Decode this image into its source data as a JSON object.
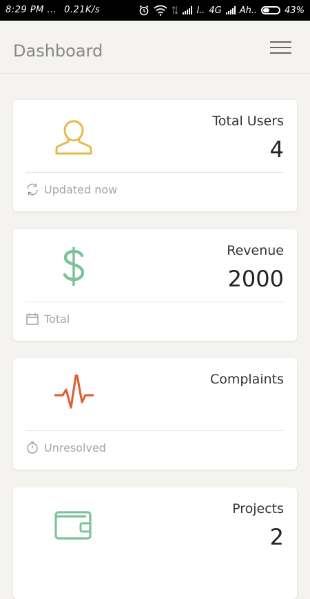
{
  "status_bar": {
    "time": "8:29 PM",
    "dots": "...",
    "speed": "0.21K/s",
    "network_a": "l..",
    "network_b": "4G",
    "carrier": "Ah..",
    "battery_percent": "43%",
    "battery_level": 0.43,
    "icons": [
      "alarm-icon",
      "wifi-icon",
      "data-arrows-icon",
      "signal-icon",
      "signal-icon",
      "battery-icon"
    ]
  },
  "header": {
    "title": "Dashboard",
    "menu_icon": "hamburger-menu-icon"
  },
  "cards": [
    {
      "label": "Total Users",
      "value": "4",
      "icon": "user-icon",
      "icon_color": "#e8b84a",
      "footer_icon": "refresh-icon",
      "footer_text": "Updated now"
    },
    {
      "label": "Revenue",
      "value": "2000",
      "icon": "dollar-icon",
      "icon_color": "#7cc39b",
      "footer_icon": "calendar-icon",
      "footer_text": "Total"
    },
    {
      "label": "Complaints",
      "value": "",
      "icon": "pulse-icon",
      "icon_color": "#e0603a",
      "footer_icon": "timer-icon",
      "footer_text": "Unresolved"
    },
    {
      "label": "Projects",
      "value": "2",
      "icon": "wallet-icon",
      "icon_color": "#7cc39b"
    }
  ]
}
